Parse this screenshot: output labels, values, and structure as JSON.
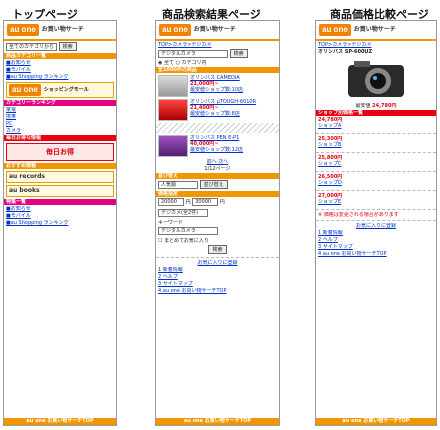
{
  "titles": {
    "top": "トップページ",
    "search": "商品検索結果ページ",
    "compare": "商品価格比較ページ"
  },
  "brand": {
    "logo": "au one",
    "service": "お買い物サーチ",
    "accent": "#f29600"
  },
  "top_page": {
    "category_select": "全てのカテゴリから",
    "search_button": "検索",
    "bar_label": "商品カテゴリ一覧",
    "links": [
      "■お知らせ",
      "■モバイル",
      "■au Shopping ランキング"
    ],
    "shopping_mall": "ショッピングモール",
    "section_1": "カテゴリーランキング",
    "rank_items": [
      "家電",
      "携帯",
      "PC",
      "カメラ"
    ],
    "section_2": "毎日お得な情報",
    "daily": "毎日お得",
    "section_3": "おすすめ情報",
    "records": "au records",
    "books": "au books",
    "section_4": "特集一覧",
    "footer": "au one お買い物サーチTOP"
  },
  "search_page": {
    "breadcrumb": "TOP>カメラ>デジカメ",
    "query": "デジタルカメラ",
    "search_button": "検索",
    "radio_1": "全て",
    "radio_2": "カテゴリ内",
    "bar_label": "全1000件の商品",
    "products": [
      {
        "name": "オリンパス CAMEDIA",
        "price": "21,000円~",
        "shops": "最安値ショップ数:10店"
      },
      {
        "name": "オリンパス μTOUGH-6010R",
        "price": "21,400円~",
        "shops": "最安値ショップ数:8店"
      },
      {
        "name": "オリンパス PEN E-P1",
        "price": "40,000円~",
        "shops": "最安値ショップ数:12店"
      }
    ],
    "paging": "前へ 次へ",
    "page_info": "1/12ページ",
    "sort_label": "並び替え",
    "sort_select": "人気順",
    "sort_button": "並び替え",
    "price_label": "価格指定",
    "price_min": "20000",
    "price_max": "30000",
    "price_unit": "円",
    "category_select": "デジカメ(全2件)",
    "keyword_label": "キーワード",
    "keyword_value": "デジタルカメラ",
    "checkbox_label": "まとめてお気に入り",
    "search_button_2": "検索",
    "help_label": "お気に入りに登録",
    "menu": [
      "1 新着情報",
      "2 ヘルプ",
      "3 サイトマップ",
      "4 au one お買い物サーチTOP"
    ],
    "footer": "au one お買い物サーチTOP"
  },
  "compare_page": {
    "breadcrumb": "TOP>カメラ>デジカメ",
    "product": "オリンパス SP-600UZ",
    "lowest_label": "最安値",
    "lowest_price": "24,780円",
    "bar_label": "ショップ別価格一覧",
    "shops": [
      {
        "price": "24,780円",
        "name": "ショップA"
      },
      {
        "price": "25,300円",
        "name": "ショップB"
      },
      {
        "price": "25,800円",
        "name": "ショップC"
      },
      {
        "price": "26,500円",
        "name": "ショップD"
      },
      {
        "price": "27,000円",
        "name": "ショップE"
      }
    ],
    "note": "※ 価格は変更される場合があります",
    "help_label": "お気に入りに登録",
    "menu": [
      "1 新着情報",
      "2 ヘルプ",
      "3 サイトマップ",
      "4 au one お買い物サーチTOP"
    ],
    "footer": "au one お買い物サーチTOP"
  }
}
